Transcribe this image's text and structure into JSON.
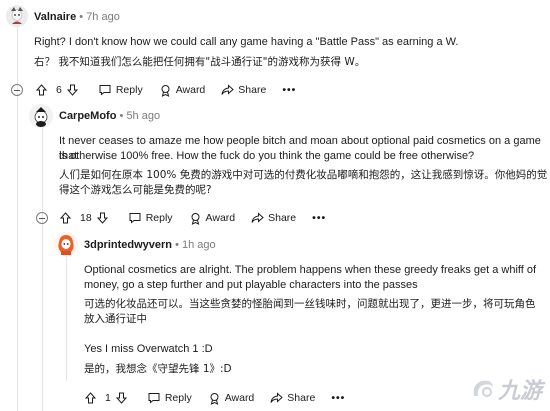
{
  "comments": [
    {
      "author": "Valnaire",
      "time": "7h ago",
      "text_en": "Right?  I don't know how we could call any game having a \"Battle Pass\" as earning a W.",
      "text_cn": "右？  我不知道我们怎么能把任何拥有\"战斗通行证\"的游戏称为获得 W。",
      "votes": "6",
      "actions": {
        "reply": "Reply",
        "award": "Award",
        "share": "Share",
        "more": "•••"
      }
    },
    {
      "author": "CarpeMofo",
      "time": "5h ago",
      "text_en_1": "It never ceases to amaze me how people bitch and moan about optional paid cosmetics on a game that",
      "text_en_2": "is otherwise 100% free. How the fuck do you think the game could be free otherwise?",
      "text_cn_1": "人们是如何在原本 100% 免费的游戏中对可选的付费化妆品嘟嘀和抱怨的，这让我感到惊讶。你他妈的觉",
      "text_cn_2": "得这个游戏怎么可能是免费的呢?",
      "votes": "18",
      "actions": {
        "reply": "Reply",
        "award": "Award",
        "share": "Share",
        "more": "•••"
      }
    },
    {
      "author": "3dprintedwyvern",
      "time": "1h ago",
      "text_en_1": "Optional cosmetics are alright. The problem happens when these greedy freaks get a whiff of",
      "text_en_2": "money, go a step further and put playable characters into the passes",
      "text_cn_1": "可选的化妆品还可以。当这些贪婪的怪胎闻到一丝钱味时，问题就出现了，更进一步，将可玩角色",
      "text_cn_2": "放入通行证中",
      "text_en_3": "Yes I miss Overwatch 1 :D",
      "text_cn_3": "是的，我想念《守望先锋 1》:D",
      "votes": "1",
      "actions": {
        "reply": "Reply",
        "award": "Award",
        "share": "Share",
        "more": "•••"
      }
    }
  ],
  "separator": "•",
  "watermark": "九游",
  "colors": {
    "accent_orange": "#ff4500",
    "muted": "#7c7c7c",
    "thread": "#e3e6e8"
  }
}
